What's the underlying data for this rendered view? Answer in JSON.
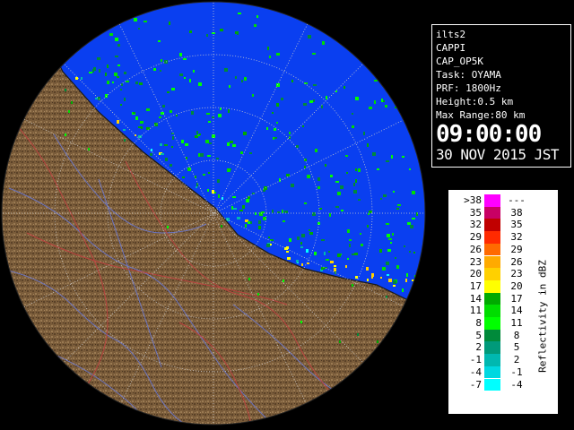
{
  "info": {
    "station": "ilts2",
    "product": "CAPPI",
    "product_code": "CAP_OP5K",
    "task": "Task: OYAMA",
    "prf": "PRF: 1800Hz",
    "height": "Height:0.5 km",
    "max_range": "Max Range:80 km",
    "time": "09:00:00",
    "date": "30 NOV 2015 JST"
  },
  "legend": {
    "unit_label": "Reflectivity in dBZ",
    "rows": [
      {
        "low": ">38",
        "high": "---",
        "color": "#ff00ff"
      },
      {
        "low": "35",
        "high": "38",
        "color": "#c80064"
      },
      {
        "low": "32",
        "high": "35",
        "color": "#c00000"
      },
      {
        "low": "29",
        "high": "32",
        "color": "#ff2a00"
      },
      {
        "low": "26",
        "high": "29",
        "color": "#ff6a00"
      },
      {
        "low": "23",
        "high": "26",
        "color": "#ffaa00"
      },
      {
        "low": "20",
        "high": "23",
        "color": "#ffd000"
      },
      {
        "low": "17",
        "high": "20",
        "color": "#ffff00"
      },
      {
        "low": "14",
        "high": "17",
        "color": "#00aa00"
      },
      {
        "low": "11",
        "high": "14",
        "color": "#00dd00"
      },
      {
        "low": "8",
        "high": "11",
        "color": "#00ff00"
      },
      {
        "low": "5",
        "high": "8",
        "color": "#008a3a"
      },
      {
        "low": "2",
        "high": "5",
        "color": "#009a7a"
      },
      {
        "low": "-1",
        "high": "2",
        "color": "#00b8b0"
      },
      {
        "low": "-4",
        "high": "-1",
        "color": "#00d8e0"
      },
      {
        "low": "-7",
        "high": "-4",
        "color": "#00ffff"
      }
    ]
  },
  "map": {
    "sea_color": "#0a3ff0",
    "land_color": "#7a5c3a",
    "background": "#000000"
  }
}
